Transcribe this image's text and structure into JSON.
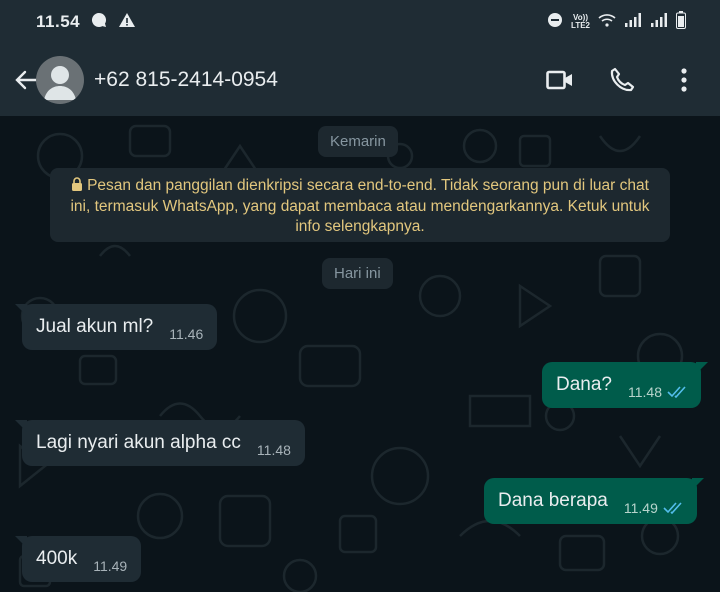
{
  "status_bar": {
    "time": "11.54",
    "network_label_top": "Vo))",
    "network_label_bottom": "LTE2",
    "icons": [
      "chat-notification-icon",
      "warning-icon",
      "do-not-disturb-icon",
      "wifi-icon",
      "signal-icon",
      "signal-icon",
      "battery-icon"
    ]
  },
  "header": {
    "contact": "+62 815-2414-0954",
    "icons": [
      "back-arrow-icon",
      "avatar",
      "video-call-icon",
      "voice-call-icon",
      "more-options-icon"
    ]
  },
  "chat": {
    "date_yesterday": "Kemarin",
    "encryption_notice": "Pesan dan panggilan dienkripsi secara end-to-end. Tidak seorang pun di luar chat ini, termasuk WhatsApp, yang dapat membaca atau mendengarkannya. Ketuk untuk info selengkapnya.",
    "date_today": "Hari ini",
    "messages": [
      {
        "direction": "incoming",
        "text": "Jual akun ml?",
        "time": "11.46"
      },
      {
        "direction": "outgoing",
        "text": "Dana?",
        "time": "11.48",
        "status": "read"
      },
      {
        "direction": "incoming",
        "text": "Lagi nyari akun alpha cc",
        "time": "11.48"
      },
      {
        "direction": "outgoing",
        "text": "Dana berapa",
        "time": "11.49",
        "status": "read"
      },
      {
        "direction": "incoming",
        "text": "400k",
        "time": "11.49"
      }
    ]
  },
  "colors": {
    "background": "#0b141a",
    "header": "#1f2c34",
    "incoming_bubble": "#1f2c34",
    "outgoing_bubble": "#005c4b",
    "read_ticks": "#53bdeb",
    "notice_text": "#e2c77e"
  }
}
